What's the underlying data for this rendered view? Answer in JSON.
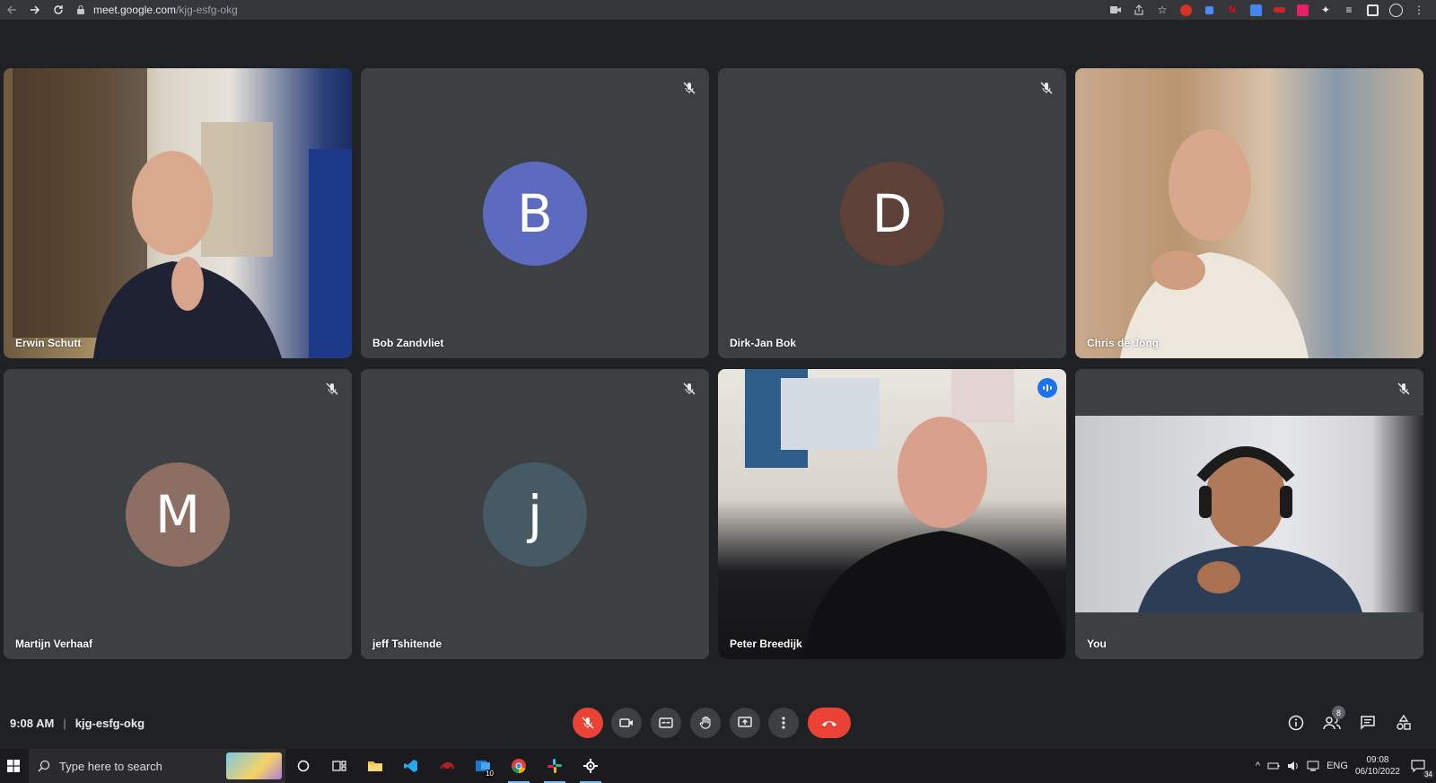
{
  "browser": {
    "url_host": "meet.google.com",
    "url_path": "/kjg-esfg-okg",
    "extensions": [
      "video-cam-icon",
      "share-icon",
      "star-icon",
      "ext-red",
      "ext-blue",
      "ext-netflix",
      "ext-translate",
      "ext-red2",
      "ext-keep",
      "puzzle-icon",
      "media-icon",
      "sidepanel-icon",
      "profile-icon",
      "kebab-icon"
    ]
  },
  "tiles": [
    {
      "name": "Erwin Schutt",
      "kind": "video",
      "muted": false
    },
    {
      "name": "Bob Zandvliet",
      "kind": "avatar",
      "initial": "B",
      "color": "#5c6bc0",
      "muted": true
    },
    {
      "name": "Dirk-Jan Bok",
      "kind": "avatar",
      "initial": "D",
      "color": "#5d4037",
      "muted": true
    },
    {
      "name": "Chris de Jong",
      "kind": "video",
      "muted": false
    },
    {
      "name": "Martijn Verhaaf",
      "kind": "avatar",
      "initial": "M",
      "color": "#8d6e63",
      "muted": true
    },
    {
      "name": "jeff Tshitende",
      "kind": "avatar",
      "initial": "j",
      "color": "#455a64",
      "muted": true
    },
    {
      "name": "Peter Breedijk",
      "kind": "video",
      "muted": false,
      "speaking": true
    },
    {
      "name": "You",
      "kind": "video",
      "muted": true
    }
  ],
  "controls": {
    "time": "9:08 AM",
    "separator": "|",
    "meeting_code": "kjg-esfg-okg",
    "participants_count": "8"
  },
  "taskbar": {
    "search_placeholder": "Type here to search",
    "outlook_badge": "10",
    "language": "ENG",
    "time": "09:08",
    "date": "06/10/2022",
    "notifications": "34"
  },
  "colors": {
    "background": "#202124",
    "tile": "#3c4043",
    "accent": "#8ab4f8",
    "red": "#ea4335"
  }
}
